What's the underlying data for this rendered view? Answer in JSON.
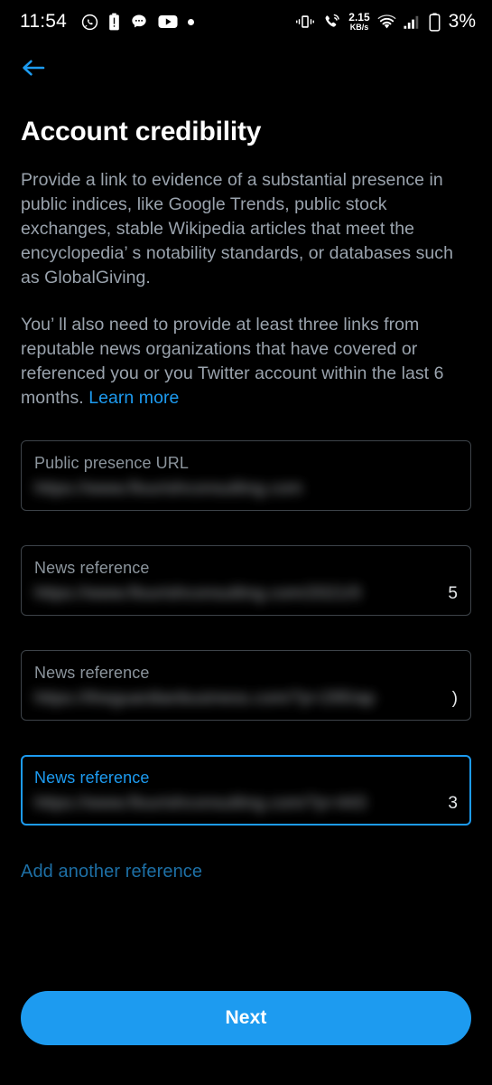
{
  "statusbar": {
    "time": "11:54",
    "left_icons": [
      "whatsapp-icon",
      "battery-alert-icon",
      "messages-icon",
      "youtube-icon",
      "dot-icon"
    ],
    "network_speed_value": "2.15",
    "network_speed_unit": "KB/s",
    "right_icons": [
      "vibrate-icon",
      "call-signal-icon",
      "wifi-icon",
      "cellular-signal-icon",
      "battery-icon"
    ],
    "battery_percent": "3%"
  },
  "nav": {
    "back_icon": "arrow-left-icon"
  },
  "page": {
    "title": "Account credibility",
    "paragraph_1": "Provide a link to evidence of a substantial presence in public indices, like Google Trends, public stock exchanges, stable Wikipedia articles that meet the encyclopedia’ s notability standards, or databases such as GlobalGiving.",
    "paragraph_2_text": "You’ ll also need to provide at least three links from reputable news organizations that have covered or referenced you or you Twitter account within the last 6 months. ",
    "learn_more_label": "Learn more"
  },
  "fields": [
    {
      "label": "Public presence URL",
      "value": "https://www.flourishconsulting.com",
      "focused": false,
      "redacted": true,
      "tail": ""
    },
    {
      "label": "News reference",
      "value": "https://www.flourishconsulting.com/2021/0",
      "focused": false,
      "redacted": true,
      "tail": "5"
    },
    {
      "label": "News reference",
      "value": "https://theguardianbusiness.com/?p=295/ap",
      "focused": false,
      "redacted": true,
      "tail": ")"
    },
    {
      "label": "News reference",
      "value": "https://www.flourishconsulting.com/?p=443",
      "focused": true,
      "redacted": true,
      "tail": "3"
    }
  ],
  "actions": {
    "add_another_label": "Add another reference",
    "next_label": "Next"
  },
  "colors": {
    "accent": "#1D9BF0",
    "background": "#000000",
    "body_text": "#9AA3AD",
    "field_border": "#3D4349",
    "add_link": "#1D6FA5"
  }
}
